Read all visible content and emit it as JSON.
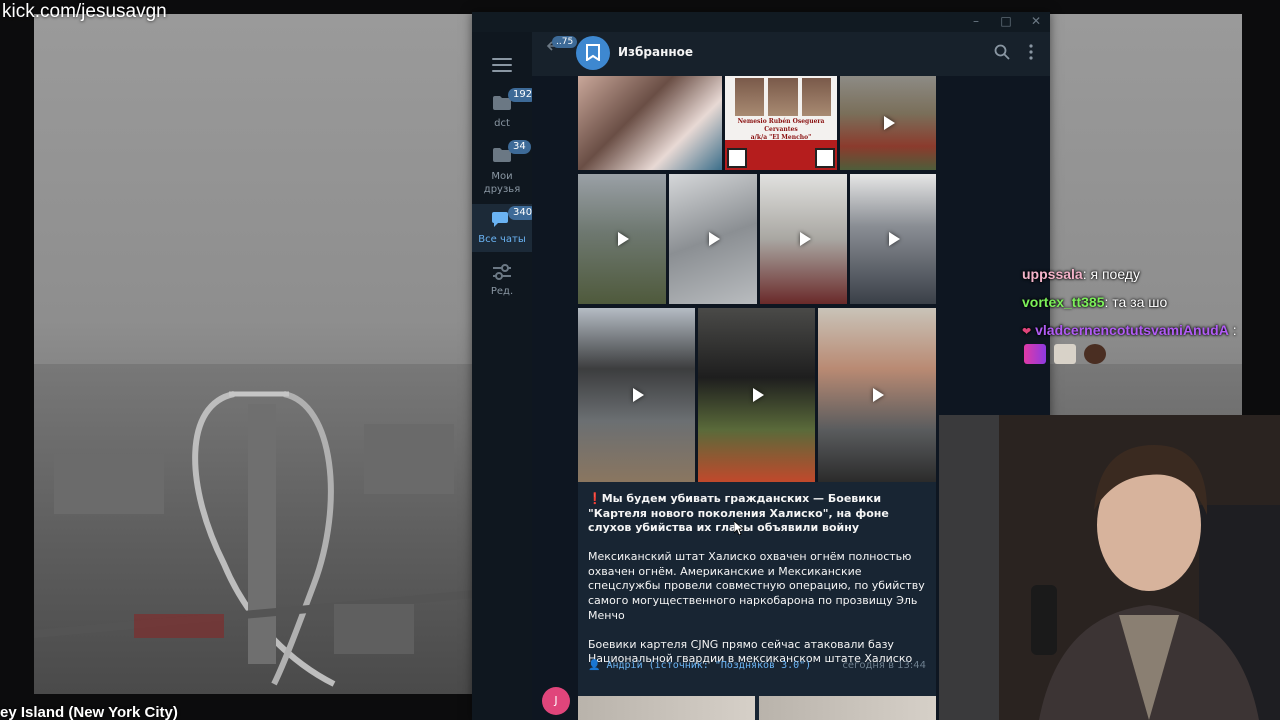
{
  "stream": {
    "channel_url": "kick.com/jesusavgn",
    "location_caption": "ey Island (New York City)"
  },
  "telegram": {
    "window_controls": [
      "–",
      "□",
      "✕"
    ],
    "sidebar": {
      "folders": [
        {
          "label": "dct",
          "badge": "192"
        },
        {
          "label": "Мои друзья",
          "badge": "34"
        },
        {
          "label": "Все чаты",
          "badge": "340"
        },
        {
          "label": "Ред.",
          "badge": ""
        }
      ]
    },
    "header": {
      "back_badge": "..75",
      "title": "Избранное"
    },
    "poster": {
      "name": "Nemesio Rubén Oseguera Cervantes",
      "alias": "a/k/a \"El Mencho\""
    },
    "post": {
      "headline": "Мы будем убивать гражданских — Боевики \"Картеля нового поколения Халиско\", на фоне слухов убийства их главы объявили войну",
      "paragraph1": "Мексиканский штат Халиско охвачен огнём полностью охвачен огнём. Американские и Мексиканские спецслужбы провели совместную операцию, по убийству самого могущественного наркобарона по прозвищу Эль Менчо",
      "paragraph2": "Боевики картеля CJNG прямо сейчас атаковали базу Национальной гвардии в мексиканском штате Халиско",
      "signature": "👤 Андрій (істочник: \"Поздняков 3.0\")",
      "time": "сегодня в 13:44"
    },
    "sender_initial": "J"
  },
  "stream_chat": [
    {
      "user": "uppssala",
      "text": ": я поеду",
      "color": "#f3b3c9"
    },
    {
      "user": "vortex_tt385",
      "text": ": та за шо",
      "color": "#7cf05a"
    },
    {
      "user": "vladcernencotutsvamiAnudA",
      "text": " :",
      "color": "#b25cf5"
    }
  ],
  "colors": {
    "window_bg": "#17212b",
    "messages_bg": "#0e1621",
    "bubble_bg": "#182533",
    "accent": "#6ab3f3",
    "badge": "#3d6a97"
  }
}
